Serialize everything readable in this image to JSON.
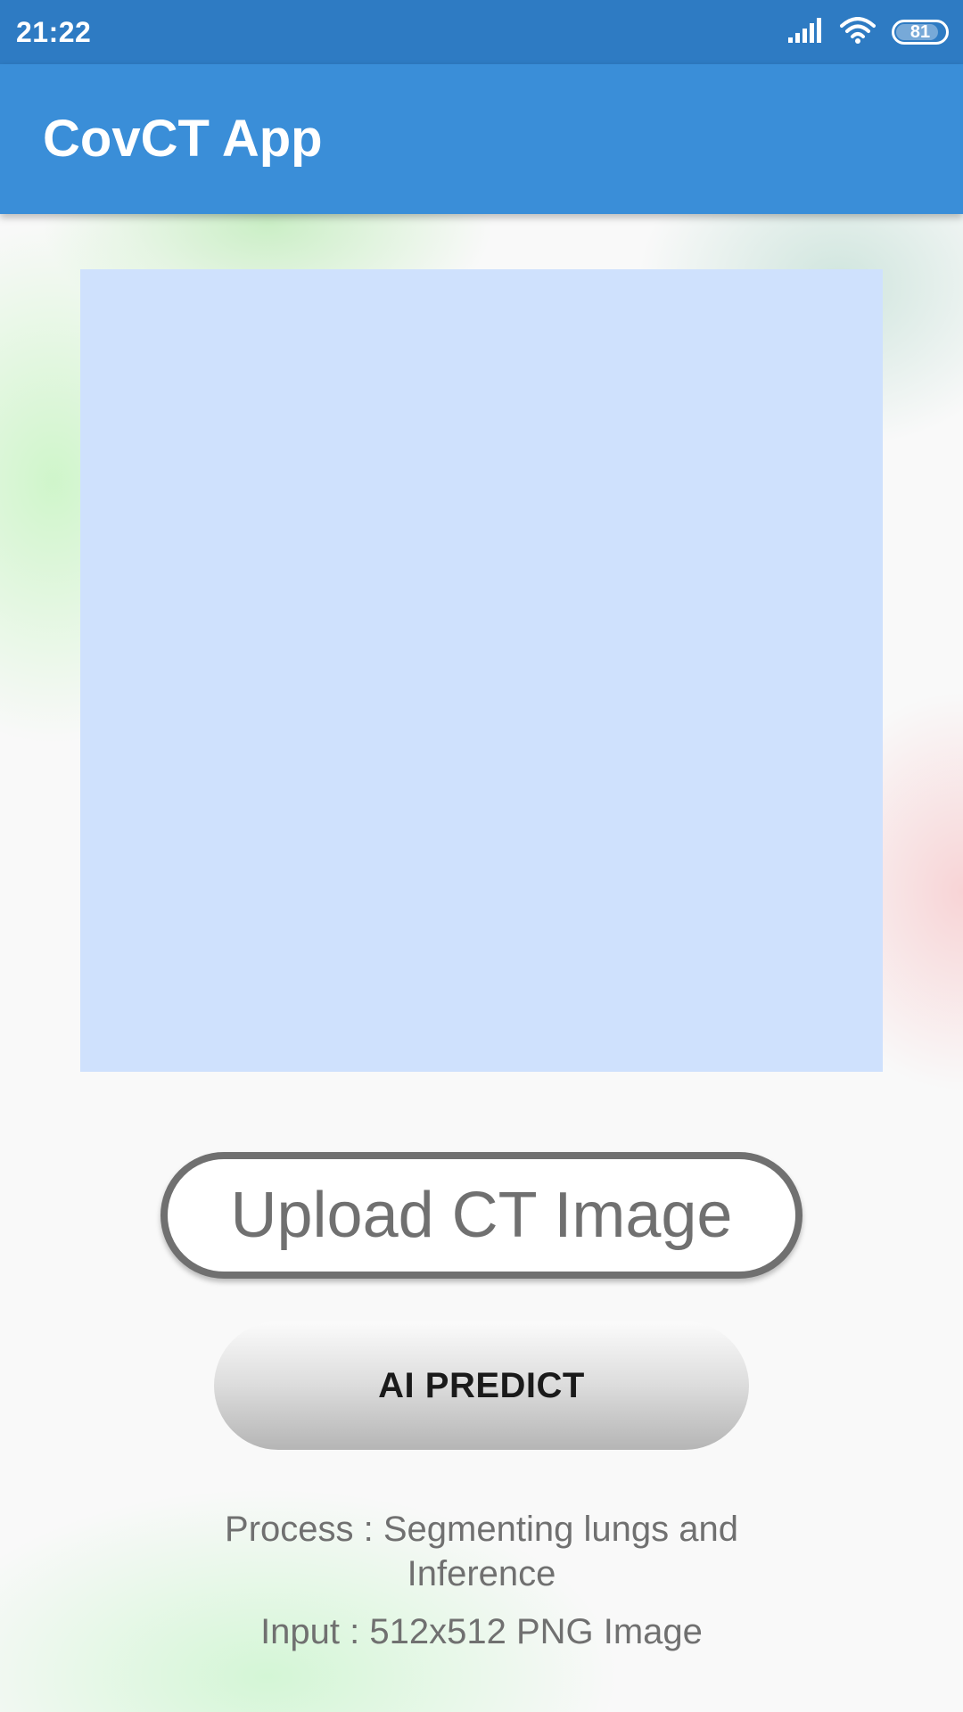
{
  "status_bar": {
    "time": "21:22",
    "battery_level": "81",
    "icons": [
      "signal-icon",
      "wifi-icon",
      "battery-icon"
    ]
  },
  "app_bar": {
    "title": "CovCT App"
  },
  "colors": {
    "status_bar": "#2e7bc3",
    "app_bar": "#3a8ed8",
    "image_placeholder": "#cfe1fd",
    "button_text_gray": "#707070"
  },
  "buttons": {
    "upload_label": "Upload CT Image",
    "predict_label": "AI PREDICT"
  },
  "info": {
    "process_text": "Process : Segmenting lungs and Inference",
    "input_text": "Input : 512x512 PNG Image"
  }
}
